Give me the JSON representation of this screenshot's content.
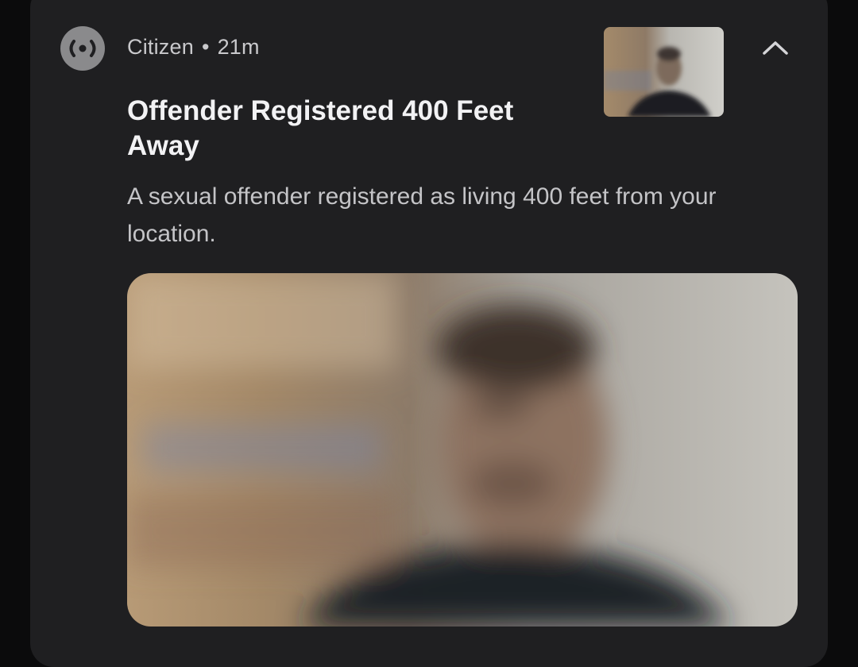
{
  "notification": {
    "app_name": "Citizen",
    "separator": "•",
    "time": "21m",
    "app_icon": "citizen-broadcast-icon",
    "expand_icon": "chevron-up-icon",
    "title": "Offender Registered 400 Feet Away",
    "body": "A sexual offender registered as living 400 feet from your location.",
    "colors": {
      "card_background": "#1f1f21",
      "page_background": "#0b0b0c",
      "app_icon_background": "#8a8a8c",
      "title_text": "#f2f2f4",
      "body_text": "#c4c4c7"
    }
  }
}
